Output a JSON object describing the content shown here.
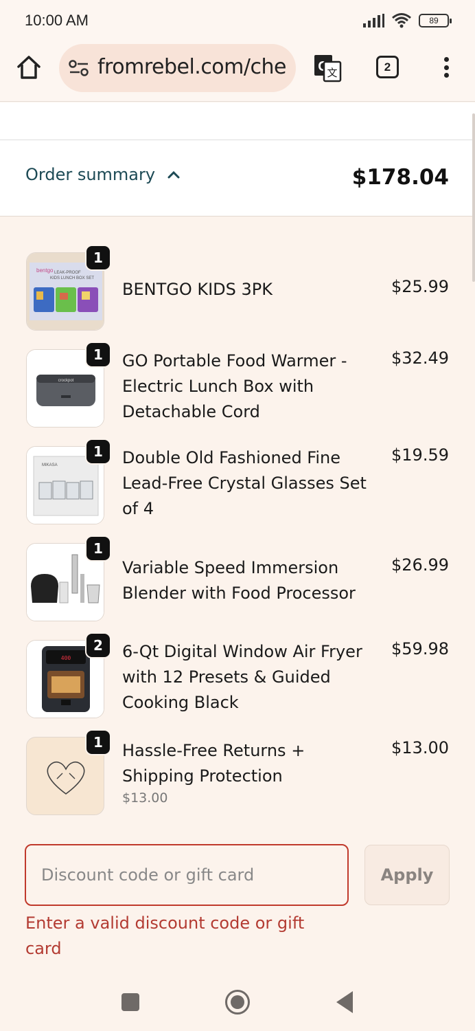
{
  "status_bar": {
    "time": "10:00 AM",
    "battery": "89"
  },
  "browser": {
    "url": "fromrebel.com/che",
    "tab_count": "2"
  },
  "summary": {
    "label": "Order summary",
    "total": "$178.04"
  },
  "items": [
    {
      "qty": "1",
      "name": "BENTGO KIDS 3PK",
      "price": "$25.99",
      "thumb_icon": "lunchbox-set-image"
    },
    {
      "qty": "1",
      "name": "GO Portable Food Warmer - Electric Lunch Box with Detachable Cord",
      "price": "$32.49",
      "thumb_icon": "food-warmer-image"
    },
    {
      "qty": "1",
      "name": "Double Old Fashioned Fine Lead-Free Crystal Glasses Set of 4",
      "price": "$19.59",
      "thumb_icon": "glasses-set-image"
    },
    {
      "qty": "1",
      "name": "Variable Speed Immersion Blender with Food Processor",
      "price": "$26.99",
      "thumb_icon": "blender-image"
    },
    {
      "qty": "2",
      "name": "6-Qt Digital Window Air Fryer with 12 Presets & Guided Cooking Black",
      "price": "$59.98",
      "thumb_icon": "air-fryer-image"
    },
    {
      "qty": "1",
      "name": "Hassle-Free Returns + Shipping Protection",
      "sub": "$13.00",
      "price": "$13.00",
      "thumb_icon": "heart-icon"
    }
  ],
  "discount": {
    "placeholder": "Discount code or gift card",
    "apply_label": "Apply",
    "error": "Enter a valid discount code or gift card"
  },
  "colors": {
    "accent": "#1d4a55",
    "error": "#b33b32",
    "page_bg": "#fcf3ec"
  }
}
